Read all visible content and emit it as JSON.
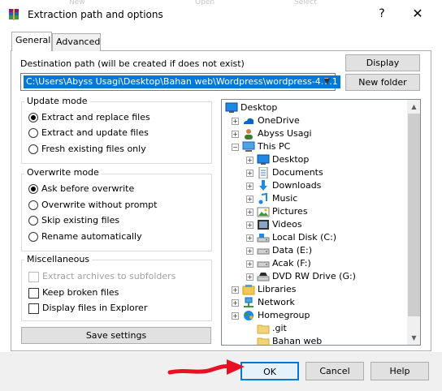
{
  "window": {
    "title": "Extraction path and options",
    "background_labels": [
      "New",
      "Open",
      "Select"
    ],
    "help_glyph": "?",
    "close_glyph": "✕"
  },
  "tabs": [
    {
      "label": "General",
      "active": true
    },
    {
      "label": "Advanced",
      "active": false
    }
  ],
  "destination": {
    "label": "Destination path (will be created if does not exist)",
    "value": "C:\\Users\\Abyss Usagi\\Desktop\\Bahan web\\Wordpress\\wordpress-4.7.1"
  },
  "buttons": {
    "display": "Display",
    "new_folder": "New folder",
    "save_settings": "Save settings",
    "ok": "OK",
    "cancel": "Cancel",
    "help": "Help"
  },
  "update_mode": {
    "title": "Update mode",
    "options": [
      {
        "label": "Extract and replace files",
        "selected": true
      },
      {
        "label": "Extract and update files",
        "selected": false
      },
      {
        "label": "Fresh existing files only",
        "selected": false
      }
    ]
  },
  "overwrite_mode": {
    "title": "Overwrite mode",
    "options": [
      {
        "label": "Ask before overwrite",
        "selected": true
      },
      {
        "label": "Overwrite without prompt",
        "selected": false
      },
      {
        "label": "Skip existing files",
        "selected": false
      },
      {
        "label": "Rename automatically",
        "selected": false
      }
    ]
  },
  "miscellaneous": {
    "title": "Miscellaneous",
    "options": [
      {
        "label": "Extract archives to subfolders",
        "checked": false,
        "enabled": false
      },
      {
        "label": "Keep broken files",
        "checked": false,
        "enabled": true
      },
      {
        "label": "Display files in Explorer",
        "checked": false,
        "enabled": true
      }
    ]
  },
  "tree": [
    {
      "label": "Desktop",
      "icon": "desktop-icon",
      "expander": ""
    },
    {
      "label": "OneDrive",
      "icon": "onedrive-icon",
      "expander": "+"
    },
    {
      "label": "Abyss Usagi",
      "icon": "user-icon",
      "expander": "+"
    },
    {
      "label": "This PC",
      "icon": "computer-icon",
      "expander": "−"
    },
    {
      "label": "Desktop",
      "icon": "desktop-icon",
      "expander": "+"
    },
    {
      "label": "Documents",
      "icon": "documents-icon",
      "expander": "+"
    },
    {
      "label": "Downloads",
      "icon": "downloads-icon",
      "expander": "+"
    },
    {
      "label": "Music",
      "icon": "music-icon",
      "expander": "+"
    },
    {
      "label": "Pictures",
      "icon": "pictures-icon",
      "expander": "+"
    },
    {
      "label": "Videos",
      "icon": "videos-icon",
      "expander": "+"
    },
    {
      "label": "Local Disk (C:)",
      "icon": "local-disk-icon",
      "expander": "+"
    },
    {
      "label": "Data (E:)",
      "icon": "drive-icon",
      "expander": "+"
    },
    {
      "label": "Acak (F:)",
      "icon": "drive-icon",
      "expander": "+"
    },
    {
      "label": "DVD RW Drive (G:)",
      "icon": "dvd-icon",
      "expander": "+"
    },
    {
      "label": "Libraries",
      "icon": "libraries-icon",
      "expander": "+"
    },
    {
      "label": "Network",
      "icon": "network-icon",
      "expander": "+"
    },
    {
      "label": "Homegroup",
      "icon": "homegroup-icon",
      "expander": "+"
    },
    {
      "label": ".git",
      "icon": "folder-icon",
      "expander": "+"
    },
    {
      "label": "Bahan web",
      "icon": "folder-icon",
      "expander": "+"
    }
  ],
  "colors": {
    "accent": "#0078d7",
    "annotation": "#e81123"
  }
}
